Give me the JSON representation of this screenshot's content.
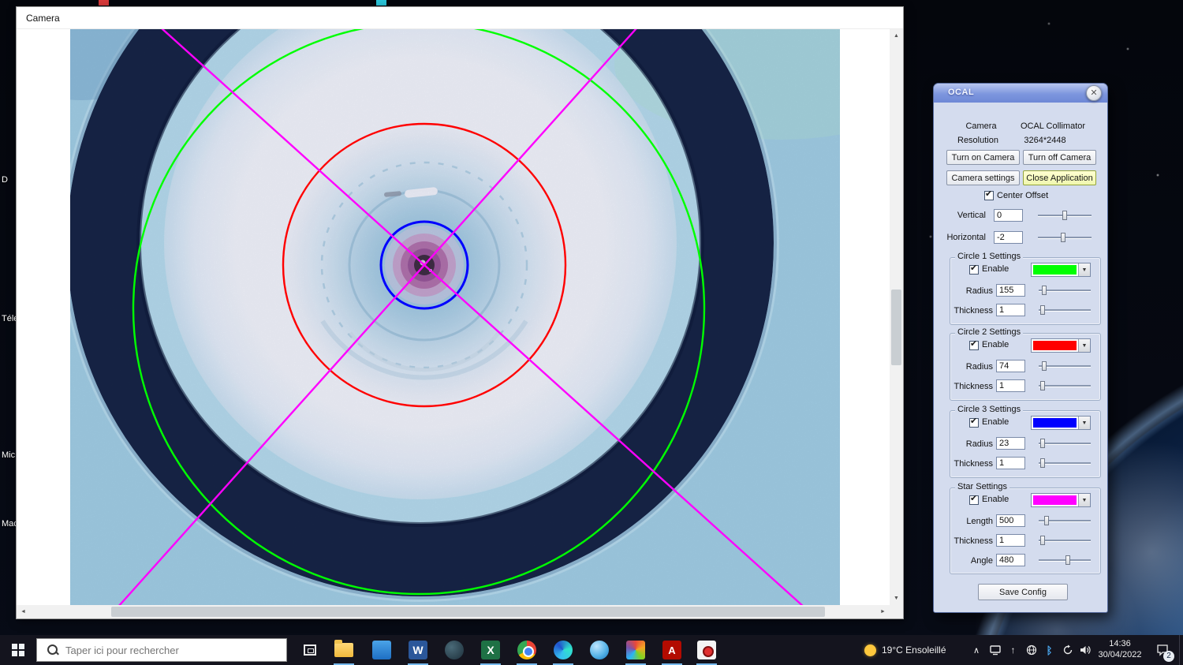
{
  "desktop": {
    "icon_labels": [
      "D",
      "Télé",
      "Mic",
      "Mac"
    ]
  },
  "camera_window": {
    "title": "Camera"
  },
  "icons": {
    "close": "✕",
    "check": "✔",
    "dropdown": "▼",
    "up": "▲",
    "down": "▼",
    "left": "◄",
    "right": "►",
    "chevron_up": "∧",
    "up_arrow": "↑"
  },
  "ocal": {
    "title": "OCAL",
    "camera_label": "Camera",
    "camera_value": "OCAL Collimator",
    "resolution_label": "Resolution",
    "resolution_value": "3264*2448",
    "turn_on": "Turn on Camera",
    "turn_off": "Turn off Camera",
    "camera_settings": "Camera settings",
    "close_application": "Close Application",
    "center_offset_label": "Center Offset",
    "vertical_label": "Vertical",
    "vertical_value": "0",
    "horizontal_label": "Horizontal",
    "horizontal_value": "-2",
    "groups": [
      {
        "title": "Circle 1 Settings",
        "enable": "Enable",
        "color": "#00ff00",
        "color_style": "background:#00ff00",
        "rows": [
          {
            "label": "Radius",
            "value": "155"
          },
          {
            "label": "Thickness",
            "value": "1"
          }
        ]
      },
      {
        "title": "Circle 2 Settings",
        "enable": "Enable",
        "color": "#ff0000",
        "color_style": "background:#ff0000",
        "rows": [
          {
            "label": "Radius",
            "value": "74"
          },
          {
            "label": "Thickness",
            "value": "1"
          }
        ]
      },
      {
        "title": "Circle 3 Settings",
        "enable": "Enable",
        "color": "#0000ff",
        "color_style": "background:#0000ff",
        "rows": [
          {
            "label": "Radius",
            "value": "23"
          },
          {
            "label": "Thickness",
            "value": "1"
          }
        ]
      },
      {
        "title": "Star Settings",
        "enable": "Enable",
        "color": "#ff00ff",
        "color_style": "background:#ff00ff",
        "rows": [
          {
            "label": "Length",
            "value": "500"
          },
          {
            "label": "Thickness",
            "value": "1"
          },
          {
            "label": "Angle",
            "value": "480"
          }
        ]
      }
    ],
    "save_config": "Save Config"
  },
  "taskbar": {
    "search_placeholder": "Taper ici pour rechercher",
    "word_letter": "W",
    "excel_letter": "X",
    "acrobat_letter": "A"
  },
  "tray": {
    "weather": "19°C  Ensoleillé",
    "time": "14:36",
    "date": "30/04/2022",
    "badge": "2"
  }
}
